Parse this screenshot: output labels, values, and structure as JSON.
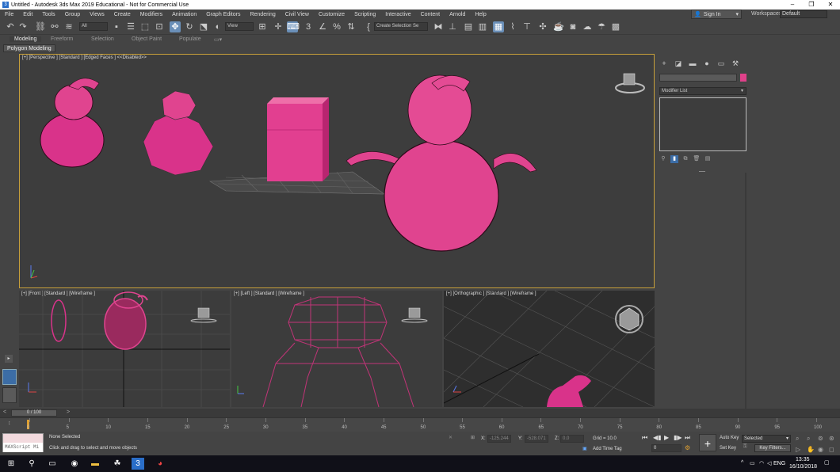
{
  "window": {
    "title": "Untitled - Autodesk 3ds Max 2019 Educational - Not for Commercial Use",
    "controls": [
      "–",
      "❐",
      "✕"
    ]
  },
  "menu": [
    "File",
    "Edit",
    "Tools",
    "Group",
    "Views",
    "Create",
    "Modifiers",
    "Animation",
    "Graph Editors",
    "Rendering",
    "Civil View",
    "Customize",
    "Scripting",
    "Interactive",
    "Content",
    "Arnold",
    "Help"
  ],
  "account": {
    "signin_label": "Sign In",
    "workspaces_label": "Workspaces:",
    "workspace_value": "Default"
  },
  "toolbar": {
    "filter_value": "All",
    "refcoord_value": "View",
    "selection_set_placeholder": "Create Selection Se"
  },
  "ribbon": {
    "tabs": [
      "Modeling",
      "Freeform",
      "Selection",
      "Object Paint",
      "Populate"
    ],
    "active_tab": "Modeling",
    "panel": "Polygon Modeling"
  },
  "viewports": {
    "perspective": "[+] [Perspective ] [Standard ] [Edged Faces ]  <<Disabled>>",
    "front": "[+] [Front ] [Standard ] [Wireframe ]",
    "left": "[+] [Left ] [Standard ] [Wireframe ]",
    "ortho": "[+] [Orthographic ] [Standard ] [Wireframe ]",
    "viewcube_front": "FRONT",
    "viewcube_left": "LEFT"
  },
  "command_panel": {
    "modifier_list": "Modifier List",
    "object_color": "#e0418a"
  },
  "timeline": {
    "frame_display": "0 / 100",
    "ticks": [
      "0",
      "5",
      "10",
      "15",
      "20",
      "25",
      "30",
      "35",
      "40",
      "45",
      "50",
      "55",
      "60",
      "65",
      "70",
      "75",
      "80",
      "85",
      "90",
      "95",
      "100"
    ]
  },
  "status": {
    "maxscript_label": "MAXScript Mi",
    "selection": "None Selected",
    "prompt": "Click and drag to select and move objects",
    "x_label": "X:",
    "x_value": "-125.244",
    "y_label": "Y:",
    "y_value": "-528.071",
    "z_label": "Z:",
    "z_value": "0.0",
    "grid": "Grid = 10.0",
    "add_time_tag": "Add Time Tag",
    "frame_value": "0",
    "auto_key": "Auto Key",
    "set_key": "Set Key",
    "selected_value": "Selected",
    "key_filters": "Key Filters..."
  },
  "taskbar": {
    "lang": "ENG",
    "time": "13:35",
    "date": "16/10/2018"
  }
}
